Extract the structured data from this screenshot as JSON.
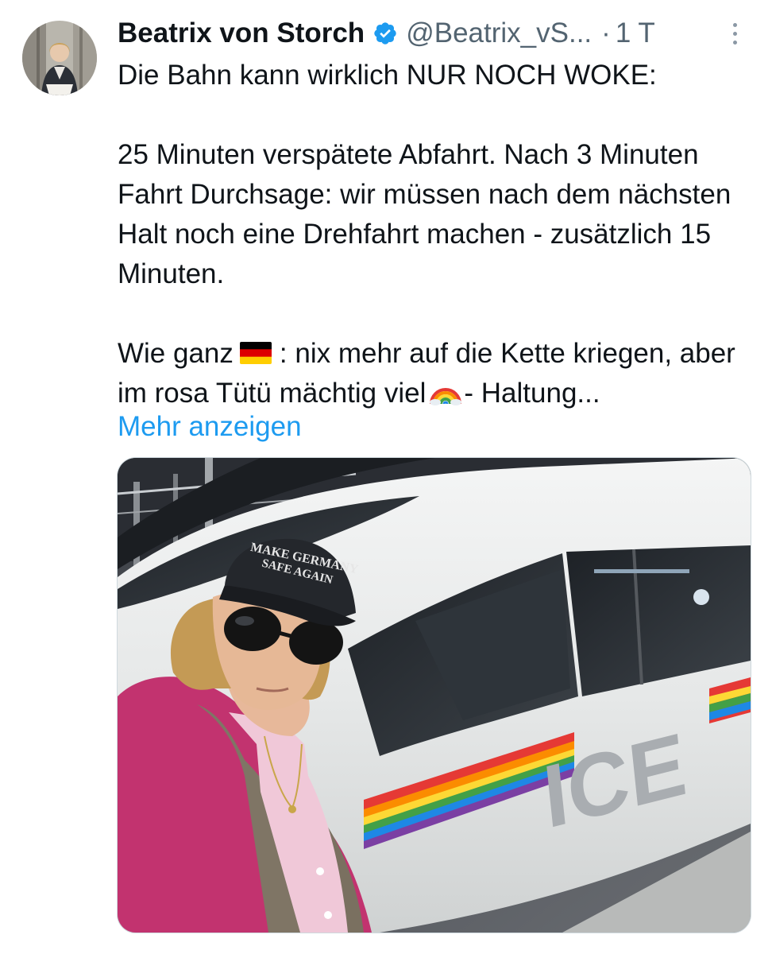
{
  "author": {
    "display_name": "Beatrix von Storch",
    "handle": "@Beatrix_vS...",
    "separator": "·",
    "time": "1 T",
    "avatar_icon": "profile-photo",
    "verified_icon": "verified-badge-icon",
    "verified_color": "#1d9bf0"
  },
  "tweet": {
    "line1": "Die Bahn kann wirklich NUR NOCH WOKE:",
    "paragraph2": "25 Minuten verspätete Abfahrt. Nach 3 Minuten Fahrt Durchsage: wir müssen nach dem nächsten Halt noch eine Drehfahrt machen - zusätzlich 15 Minuten.",
    "p3_part1": "Wie ganz",
    "p3_flag_emoji": "german-flag-emoji",
    "p3_part2": ": nix mehr auf die Kette kriegen, aber im rosa Tütü mächtig viel",
    "p3_rainbow_emoji": "rainbow-emoji",
    "p3_part3": "- Haltung...",
    "show_more": "Mehr anzeigen"
  },
  "media": {
    "cap_text_line1": "MAKE GERMANY",
    "cap_text_line2": "SAFE AGAIN",
    "train_logo": "ICE"
  },
  "colors": {
    "text": "#0f1419",
    "secondary": "#536471",
    "link": "#1d9bf0"
  }
}
